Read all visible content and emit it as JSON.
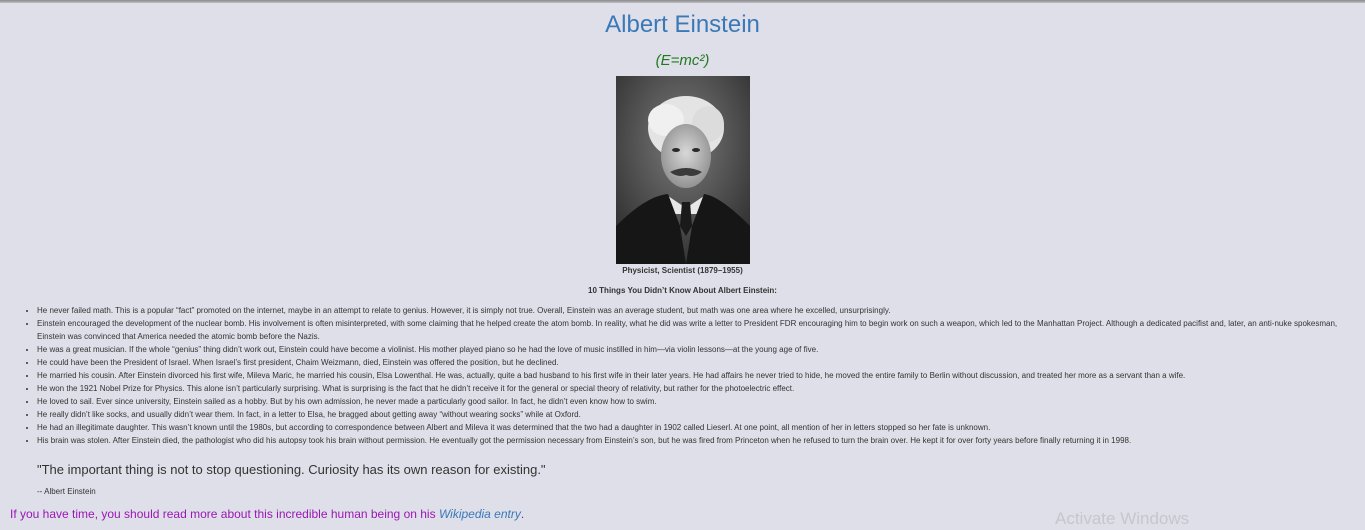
{
  "header": {
    "title": "Albert Einstein",
    "formula": "(E=mc²)"
  },
  "photo": {
    "caption": "Physicist, Scientist (1879–1955)"
  },
  "facts": {
    "heading": "10 Things You Didn’t Know About Albert Einstein:",
    "items": [
      "He never failed math. This is a popular “fact” promoted on the internet, maybe in an attempt to relate to genius. However, it is simply not true. Overall, Einstein was an average student, but math was one area where he excelled, unsurprisingly.",
      "Einstein encouraged the development of the nuclear bomb. His involvement is often misinterpreted, with some claiming that he helped create the atom bomb. In reality, what he did was write a letter to President FDR encouraging him to begin work on such a weapon, which led to the Manhattan Project. Although a dedicated pacifist and, later, an anti-nuke spokesman, Einstein was convinced that America needed the atomic bomb before the Nazis.",
      "He was a great musician. If the whole “genius” thing didn’t work out, Einstein could have become a violinist. His mother played piano so he had the love of music instilled in him—via violin lessons—at the young age of five.",
      "He could have been the President of Israel. When Israel’s first president, Chaim Weizmann, died, Einstein was offered the position, but he declined.",
      "He married his cousin. After Einstein divorced his first wife, Mileva Maric, he married his cousin, Elsa Lowenthal. He was, actually, quite a bad husband to his first wife in their later years. He had affairs he never tried to hide, he moved the entire family to Berlin without discussion, and treated her more as a servant than a wife.",
      "He won the 1921 Nobel Prize for Physics. This alone isn’t particularly surprising. What is surprising is the fact that he didn’t receive it for the general or special theory of relativity, but rather for the photoelectric effect.",
      "He loved to sail. Ever since university, Einstein sailed as a hobby. But by his own admission, he never made a particularly good sailor. In fact, he didn’t even know how to swim.",
      "He really didn’t like socks, and usually didn’t wear them. In fact, in a letter to Elsa, he bragged about getting away “without wearing socks” while at Oxford.",
      "He had an illegitimate daughter. This wasn’t known until the 1980s, but according to correspondence between Albert and Mileva it was determined that the two had a daughter in 1902 called Lieserl. At one point, all mention of her in letters stopped so her fate is unknown.",
      "His brain was stolen. After Einstein died, the pathologist who did his autopsy took his brain without permission. He eventually got the permission necessary from Einstein’s son, but he was fired from Princeton when he refused to turn the brain over. He kept it for over forty years before finally returning it in 1998."
    ]
  },
  "quote": {
    "text": "\"The important thing is not to stop questioning. Curiosity has its own reason for existing.\"",
    "author": "-- Albert Einstein"
  },
  "footer": {
    "text": "If you have time, you should read more about this incredible human being on his ",
    "link_label": "Wikipedia entry",
    "end": "."
  },
  "watermark": "Activate Windows",
  "colors": {
    "background": "#dfdfe9",
    "title": "#3a79b8",
    "formula": "#1f7a1f",
    "footer_text": "#9a17b5",
    "link": "#3a79b8"
  }
}
